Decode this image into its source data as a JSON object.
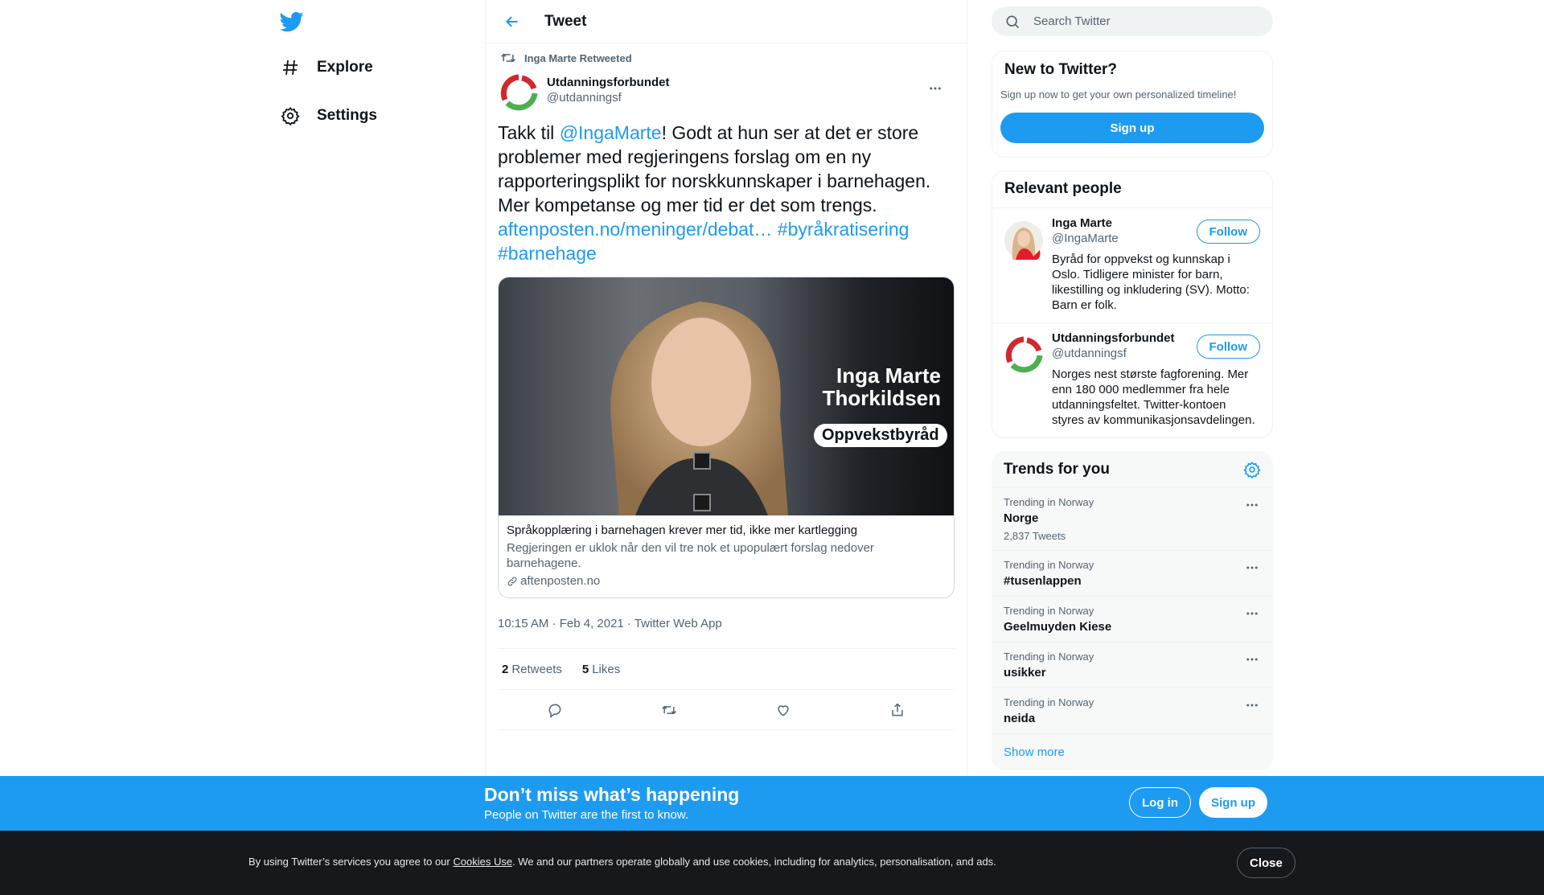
{
  "nav": {
    "items": [
      {
        "label": "Explore",
        "icon": "hashtag-icon"
      },
      {
        "label": "Settings",
        "icon": "gear-icon"
      }
    ]
  },
  "header": {
    "title": "Tweet"
  },
  "tweet": {
    "retweeted_by": "Inga Marte Retweeted",
    "author_name": "Utdanningsforbundet",
    "author_handle": "@utdanningsf",
    "text_part1": "Takk til ",
    "mention": "@IngaMarte",
    "text_part2": "! Godt at hun ser at det er store problemer med regjeringens forslag om en ny rapporteringsplikt for norskkunnskaper i barnehagen. Mer kompetanse og mer tid er det som trengs.",
    "link": "aftenposten.no/meninger/debat…",
    "hashtag1": "#byråkratisering",
    "hashtag2": "#barnehage",
    "card": {
      "image_name_line1": "Inga Marte",
      "image_name_line2": "Thorkildsen",
      "image_badge": "Oppvekstbyråd",
      "title": "Språkopplæring i barnehagen krever mer tid, ikke mer kartlegging",
      "description": "Regjeringen er uklok når den vil tre nok et upopulært forslag nedover barnehagene.",
      "domain": "aftenposten.no"
    },
    "timestamp": "10:15 AM · Feb 4, 2021 · Twitter Web App",
    "retweets_count": "2",
    "retweets_label": "Retweets",
    "likes_count": "5",
    "likes_label": "Likes"
  },
  "search": {
    "placeholder": "Search Twitter"
  },
  "new_to_twitter": {
    "title": "New to Twitter?",
    "subtitle": "Sign up now to get your own personalized timeline!",
    "button": "Sign up"
  },
  "relevant_people": {
    "title": "Relevant people",
    "people": [
      {
        "name": "Inga Marte",
        "handle": "@IngaMarte",
        "bio": "Byråd for oppvekst og kunnskap i Oslo. Tidligere minister for barn, likestilling og inkludering (SV). Motto: Barn er folk.",
        "button": "Follow"
      },
      {
        "name": "Utdanningsforbundet",
        "handle": "@utdanningsf",
        "bio": "Norges nest største fagforening. Mer enn 180 000 medlemmer fra hele utdanningsfeltet. Twitter-kontoen styres av kommunikasjonsavdelingen.",
        "button": "Follow"
      }
    ]
  },
  "trends": {
    "title": "Trends for you",
    "items": [
      {
        "meta": "Trending in Norway",
        "name": "Norge",
        "count": "2,837 Tweets"
      },
      {
        "meta": "Trending in Norway",
        "name": "#tusenlappen",
        "count": ""
      },
      {
        "meta": "Trending in Norway",
        "name": "Geelmuyden Kiese",
        "count": ""
      },
      {
        "meta": "Trending in Norway",
        "name": "usikker",
        "count": ""
      },
      {
        "meta": "Trending in Norway",
        "name": "neida",
        "count": ""
      }
    ],
    "show_more": "Show more"
  },
  "banner": {
    "title": "Don’t miss what’s happening",
    "subtitle": "People on Twitter are the first to know.",
    "login": "Log in",
    "signup": "Sign up"
  },
  "cookie": {
    "text_before": "By using Twitter’s services you agree to our ",
    "link": "Cookies Use",
    "text_after": ". We and our partners operate globally and use cookies, including for analytics, personalisation, and ads.",
    "close": "Close"
  },
  "colors": {
    "accent": "#1d9bf0",
    "text": "#0f1419",
    "muted": "#536471"
  }
}
